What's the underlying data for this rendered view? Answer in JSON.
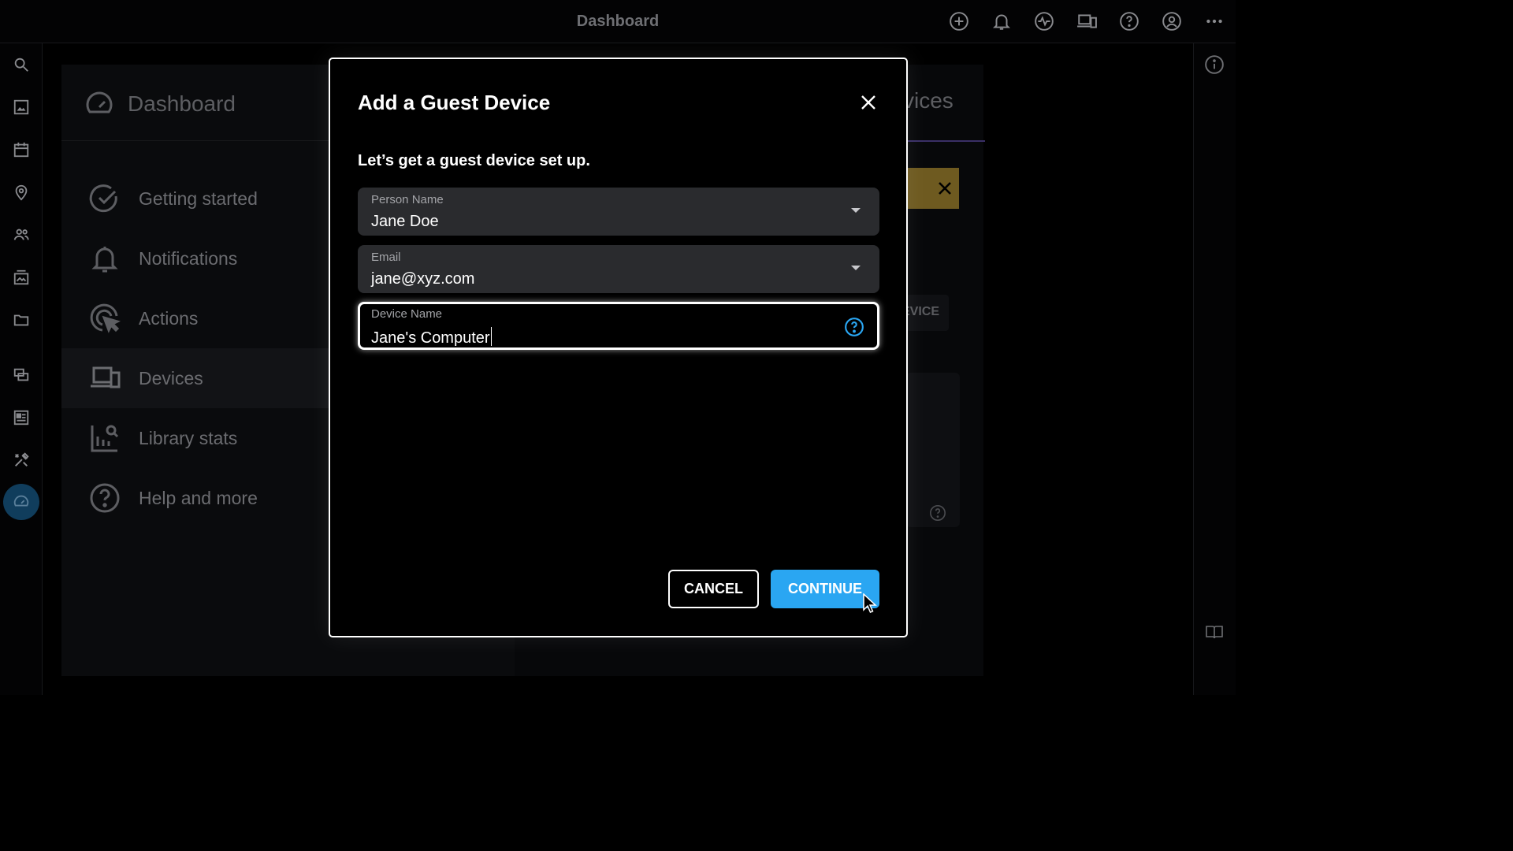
{
  "topbar": {
    "title": "Dashboard",
    "icons": [
      "add-circle-icon",
      "bell-icon",
      "activity-icon",
      "devices-icon",
      "help-icon",
      "account-icon",
      "more-icon"
    ]
  },
  "rail": {
    "icons": [
      "search-icon",
      "image-icon",
      "calendar-icon",
      "location-icon",
      "people-icon",
      "album-icon",
      "folder-icon",
      "slideshow-icon",
      "dashboard-panel-icon",
      "tools-icon",
      "dashboard-icon"
    ],
    "active": "dashboard-icon"
  },
  "settings_nav": {
    "header": "Dashboard",
    "items": [
      {
        "label": "Getting started",
        "icon": "check-circle-icon"
      },
      {
        "label": "Notifications",
        "icon": "bell-icon"
      },
      {
        "label": "Actions",
        "icon": "click-icon"
      },
      {
        "label": "Devices",
        "icon": "devices-icon",
        "selected": true
      },
      {
        "label": "Library stats",
        "icon": "stats-icon"
      },
      {
        "label": "Help and more",
        "icon": "help-icon"
      }
    ]
  },
  "background": {
    "heading_fragment": "vices",
    "button_fragment": "EVICE"
  },
  "modal": {
    "title": "Add a Guest Device",
    "subtitle": "Let’s get a guest device set up.",
    "fields": {
      "person": {
        "label": "Person Name",
        "value": "Jane Doe"
      },
      "email": {
        "label": "Email",
        "value": "jane@xyz.com"
      },
      "device": {
        "label": "Device Name",
        "value": "Jane's Computer"
      }
    },
    "cancel_label": "CANCEL",
    "continue_label": "CONTINUE"
  },
  "colors": {
    "accent": "#2aa6f2",
    "field_bg": "#2a2b2e",
    "banner": "#6e5a20"
  }
}
